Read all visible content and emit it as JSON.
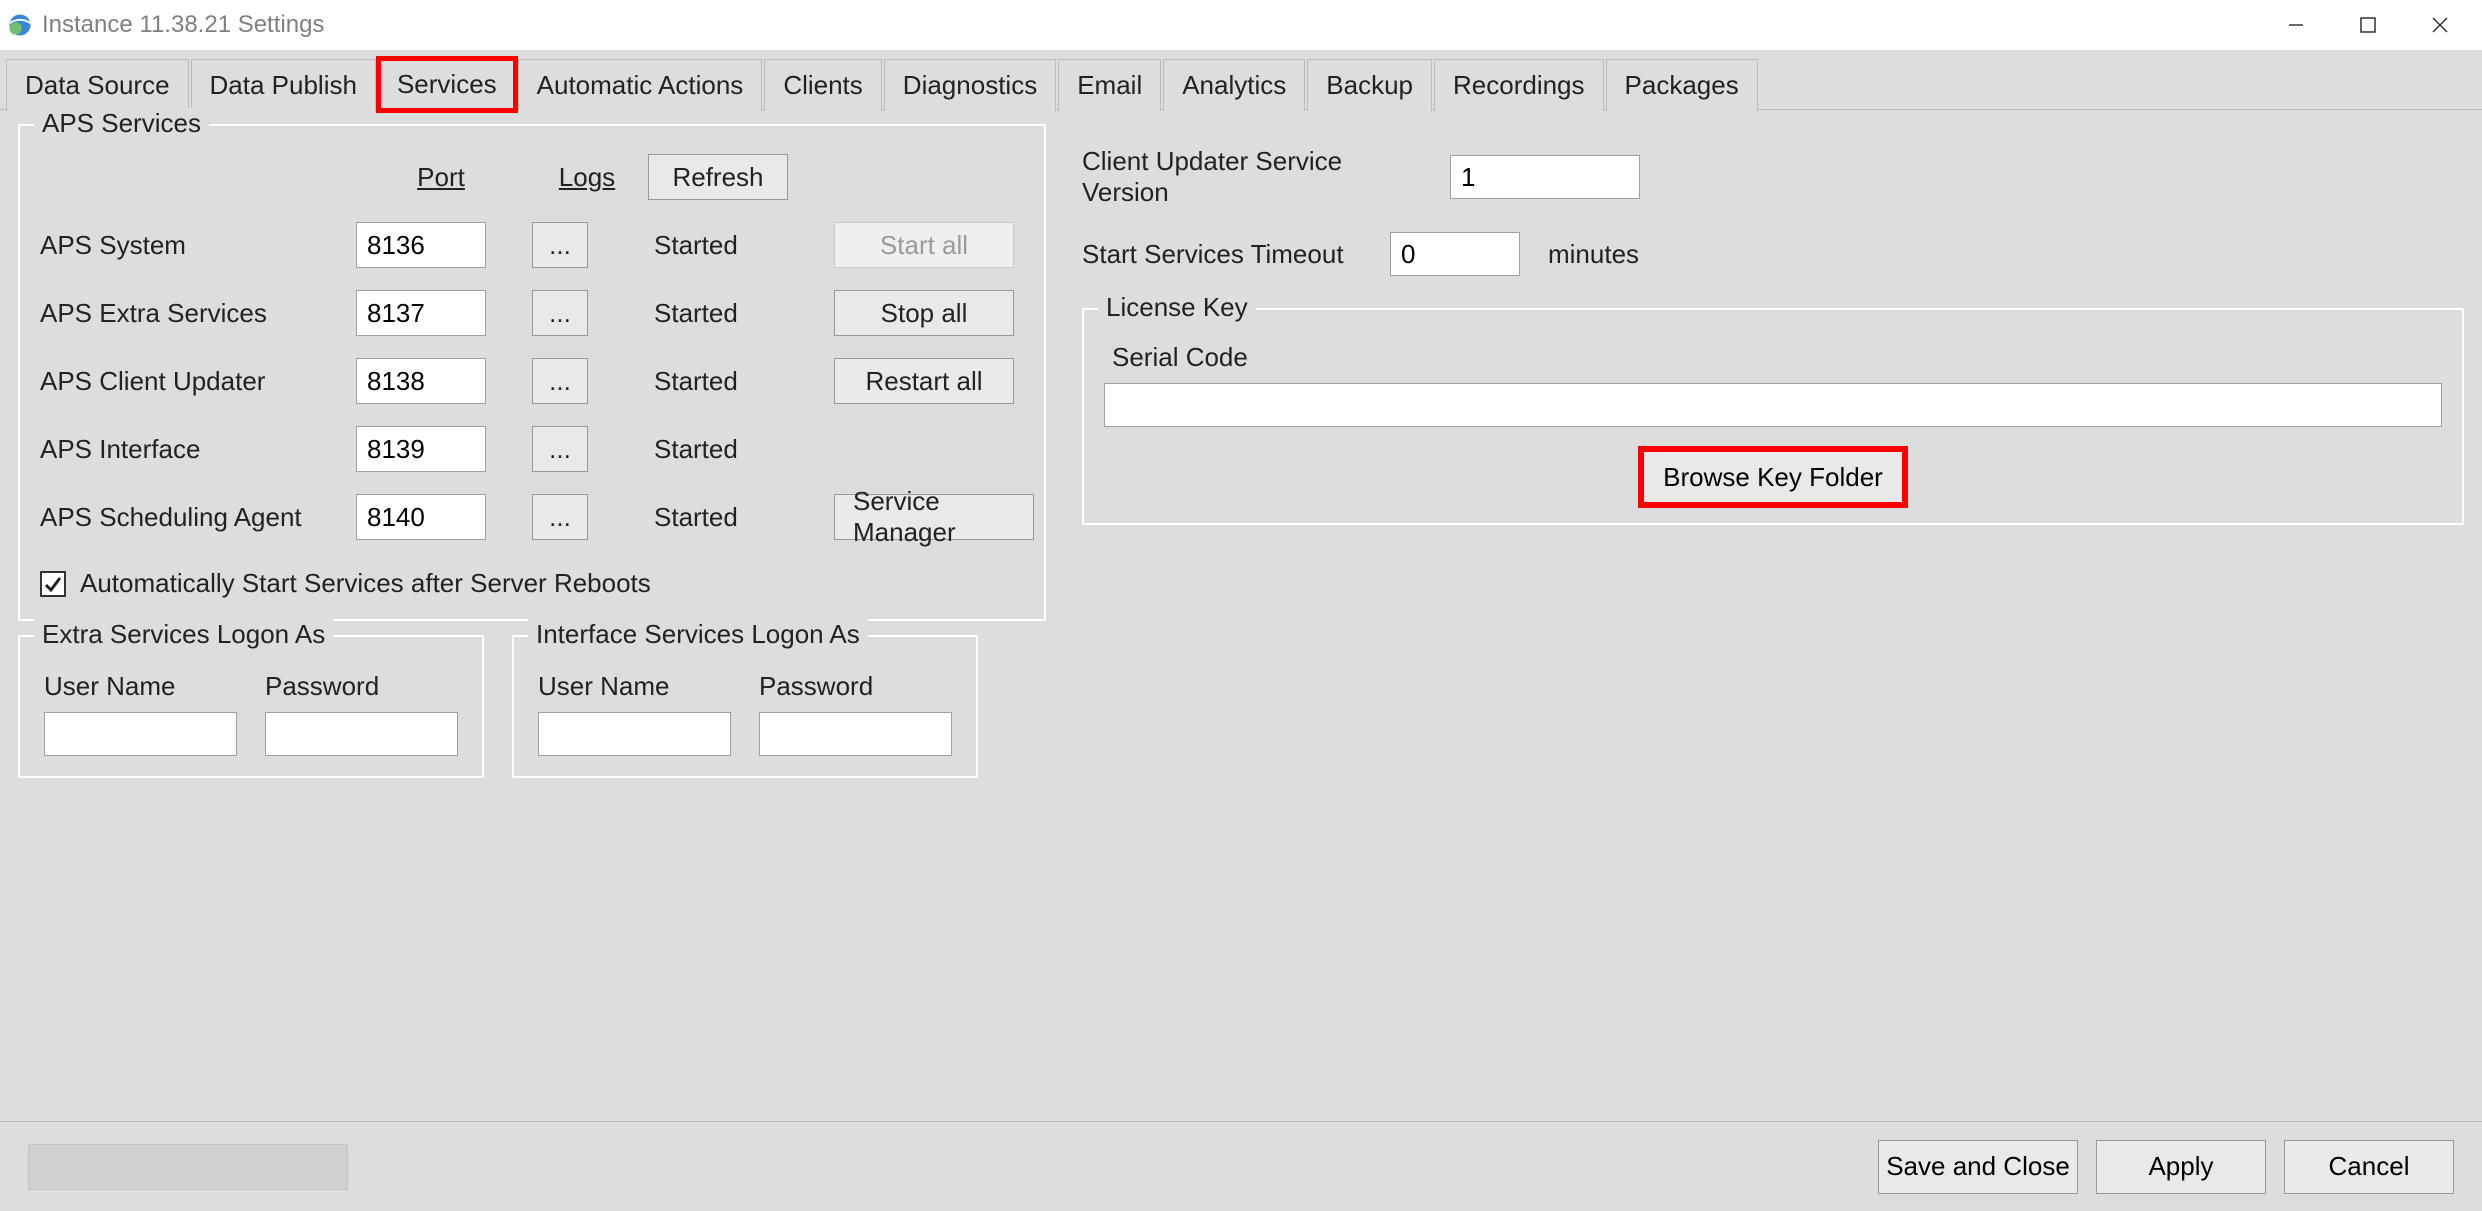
{
  "window": {
    "title": "Instance 11.38.21 Settings"
  },
  "tabs": [
    "Data Source",
    "Data Publish",
    "Services",
    "Automatic Actions",
    "Clients",
    "Diagnostics",
    "Email",
    "Analytics",
    "Backup",
    "Recordings",
    "Packages"
  ],
  "active_tab_index": 2,
  "aps": {
    "legend": "APS Services",
    "headers": {
      "port": "Port",
      "logs": "Logs"
    },
    "refresh": "Refresh",
    "logs_btn": "...",
    "services": [
      {
        "name": "APS System",
        "port": "8136",
        "status": "Started"
      },
      {
        "name": "APS Extra Services",
        "port": "8137",
        "status": "Started"
      },
      {
        "name": "APS Client Updater",
        "port": "8138",
        "status": "Started"
      },
      {
        "name": "APS Interface",
        "port": "8139",
        "status": "Started"
      },
      {
        "name": "APS Scheduling Agent",
        "port": "8140",
        "status": "Started"
      }
    ],
    "ops": {
      "start_all": "Start all",
      "stop_all": "Stop all",
      "restart_all": "Restart all",
      "service_manager": "Service Manager"
    },
    "auto_start": {
      "checked": true,
      "label": "Automatically Start Services after Server Reboots"
    }
  },
  "right": {
    "version_label": "Client Updater Service Version",
    "version_value": "1",
    "timeout_label": "Start Services Timeout",
    "timeout_value": "0",
    "timeout_suffix": "minutes",
    "license": {
      "legend": "License Key",
      "serial_label": "Serial Code",
      "serial_value": "",
      "browse": "Browse Key Folder"
    }
  },
  "logon": {
    "extra": {
      "legend": "Extra Services Logon As",
      "user_label": "User Name",
      "pass_label": "Password",
      "user": "",
      "pass": ""
    },
    "iface": {
      "legend": "Interface Services Logon As",
      "user_label": "User Name",
      "pass_label": "Password",
      "user": "",
      "pass": ""
    }
  },
  "footer": {
    "save_close": "Save and Close",
    "apply": "Apply",
    "cancel": "Cancel"
  }
}
